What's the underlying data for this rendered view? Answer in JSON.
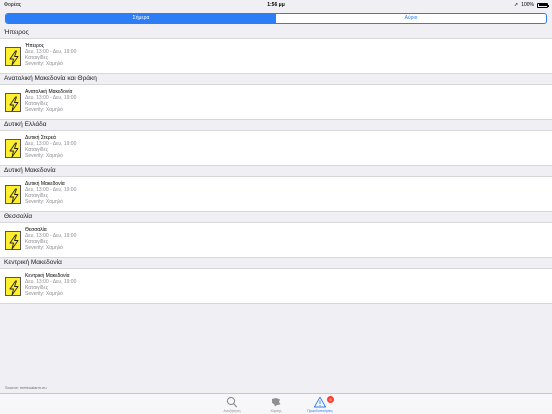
{
  "status_bar": {
    "carrier": "Φορέας",
    "time": "1:56 μμ",
    "battery": "100%"
  },
  "segments": [
    {
      "label": "Σήμερα",
      "active": true
    },
    {
      "label": "Αύριο",
      "active": false
    }
  ],
  "sections": [
    {
      "header": "Ήπειρος",
      "item": {
        "title": "Ήπειρος",
        "time": "Δευ, 13:00 - Δευ, 19:00",
        "type": "Καταιγίδες",
        "severity": "Severity: Χαμηλό"
      }
    },
    {
      "header": "Ανατολική Μακεδονία και Θράκη",
      "item": {
        "title": "Ανατολική Μακεδονία",
        "time": "Δευ, 13:00 - Δευ, 19:00",
        "type": "Καταιγίδες",
        "severity": "Severity: Χαμηλό"
      }
    },
    {
      "header": "Δυτική Ελλάδα",
      "item": {
        "title": "Δυτική Στερεά",
        "time": "Δευ, 13:00 - Δευ, 19:00",
        "type": "Καταιγίδες",
        "severity": "Severity: Χαμηλό"
      }
    },
    {
      "header": "Δυτική Μακεδονία",
      "item": {
        "title": "Δυτική Μακεδονία",
        "time": "Δευ, 13:00 - Δευ, 19:00",
        "type": "Καταιγίδες",
        "severity": "Severity: Χαμηλό"
      }
    },
    {
      "header": "Θεσσαλία",
      "item": {
        "title": "Θεσσαλία",
        "time": "Δευ, 13:00 - Δευ, 19:00",
        "type": "Καταιγίδες",
        "severity": "Severity: Χαμηλό"
      }
    },
    {
      "header": "Κεντρική Μακεδονία",
      "item": {
        "title": "Κεντρική Μακεδονία",
        "time": "Δευ, 13:00 - Δευ, 19:00",
        "type": "Καταιγίδες",
        "severity": "Severity: Χαμηλό"
      }
    }
  ],
  "source": "Source: meteoalarm.eu",
  "tabs": [
    {
      "label": "Αναζήτηση",
      "icon": "search-icon"
    },
    {
      "label": "Χάρτης",
      "icon": "map-icon"
    },
    {
      "label": "Προειδοποιήσεις",
      "icon": "warning-icon",
      "badge": "6",
      "active": true
    }
  ],
  "colors": {
    "accent": "#2d7df6",
    "warning_yellow": "#ffef2e",
    "badge_red": "#ff3b30",
    "background": "#efeff4"
  }
}
